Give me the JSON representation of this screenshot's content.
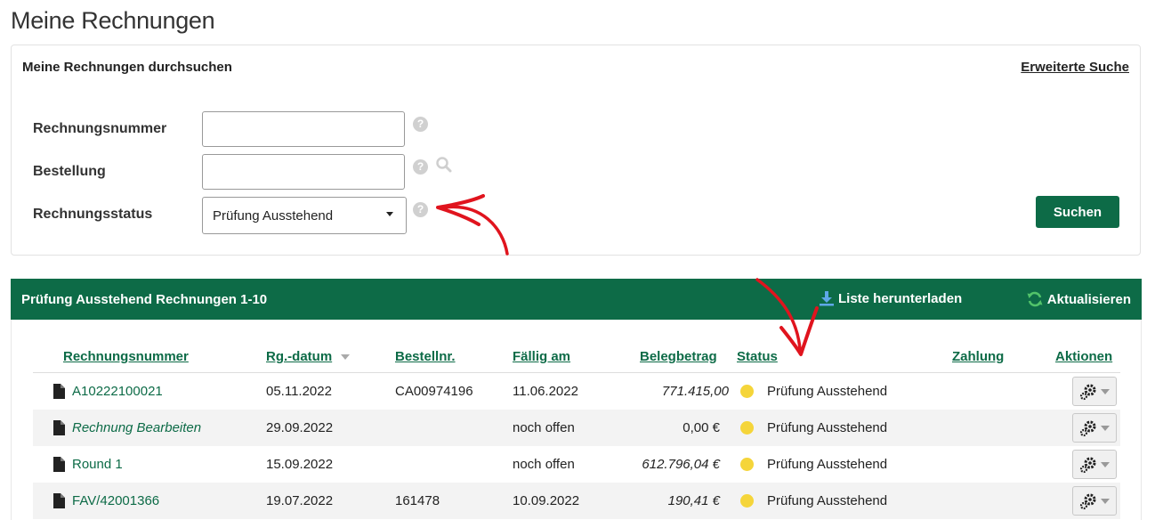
{
  "page": {
    "title": "Meine Rechnungen"
  },
  "search": {
    "panel_title": "Meine Rechnungen durchsuchen",
    "advanced_link": "Erweiterte Suche",
    "fields": {
      "invoice_number_label": "Rechnungsnummer",
      "invoice_number_value": "",
      "order_label": "Bestellung",
      "order_value": "",
      "status_label": "Rechnungsstatus",
      "status_selected": "Prüfung Ausstehend"
    },
    "help_glyph": "?",
    "submit_label": "Suchen"
  },
  "results": {
    "title": "Prüfung Ausstehend Rechnungen 1-10",
    "download_label": "Liste herunterladen",
    "refresh_label": "Aktualisieren",
    "columns": {
      "invoice_number": "Rechnungsnummer",
      "invoice_date": "Rg.-datum",
      "order_number": "Bestellnr.",
      "due_date": "Fällig am",
      "amount": "Belegbetrag",
      "status": "Status",
      "payment": "Zahlung",
      "actions": "Aktionen"
    },
    "rows": [
      {
        "invoice": "A10222100021",
        "date": "05.11.2022",
        "order": "CA00974196",
        "due": "11.06.2022",
        "amount": "771.415,00",
        "status": "Prüfung Ausstehend"
      },
      {
        "invoice": "Rechnung Bearbeiten",
        "date": "29.09.2022",
        "order": "",
        "due": "noch offen",
        "amount": "0,00 €",
        "status": "Prüfung Ausstehend"
      },
      {
        "invoice": "Round 1",
        "date": "15.09.2022",
        "order": "",
        "due": "noch offen",
        "amount": "612.796,04 €",
        "status": "Prüfung Ausstehend"
      },
      {
        "invoice": "FAV/42001366",
        "date": "19.07.2022",
        "order": "161478",
        "due": "10.09.2022",
        "amount": "190,41 €",
        "status": "Prüfung Ausstehend"
      }
    ]
  },
  "colors": {
    "brand_green": "#0d6b47",
    "status_pending": "#f5d53a",
    "annotation_red": "#e0141e"
  },
  "icons": {
    "help": "question-circle-icon",
    "lookup": "magnifier-icon",
    "download": "download-icon",
    "refresh": "refresh-icon",
    "document": "document-icon",
    "actions": "gear-icon"
  }
}
